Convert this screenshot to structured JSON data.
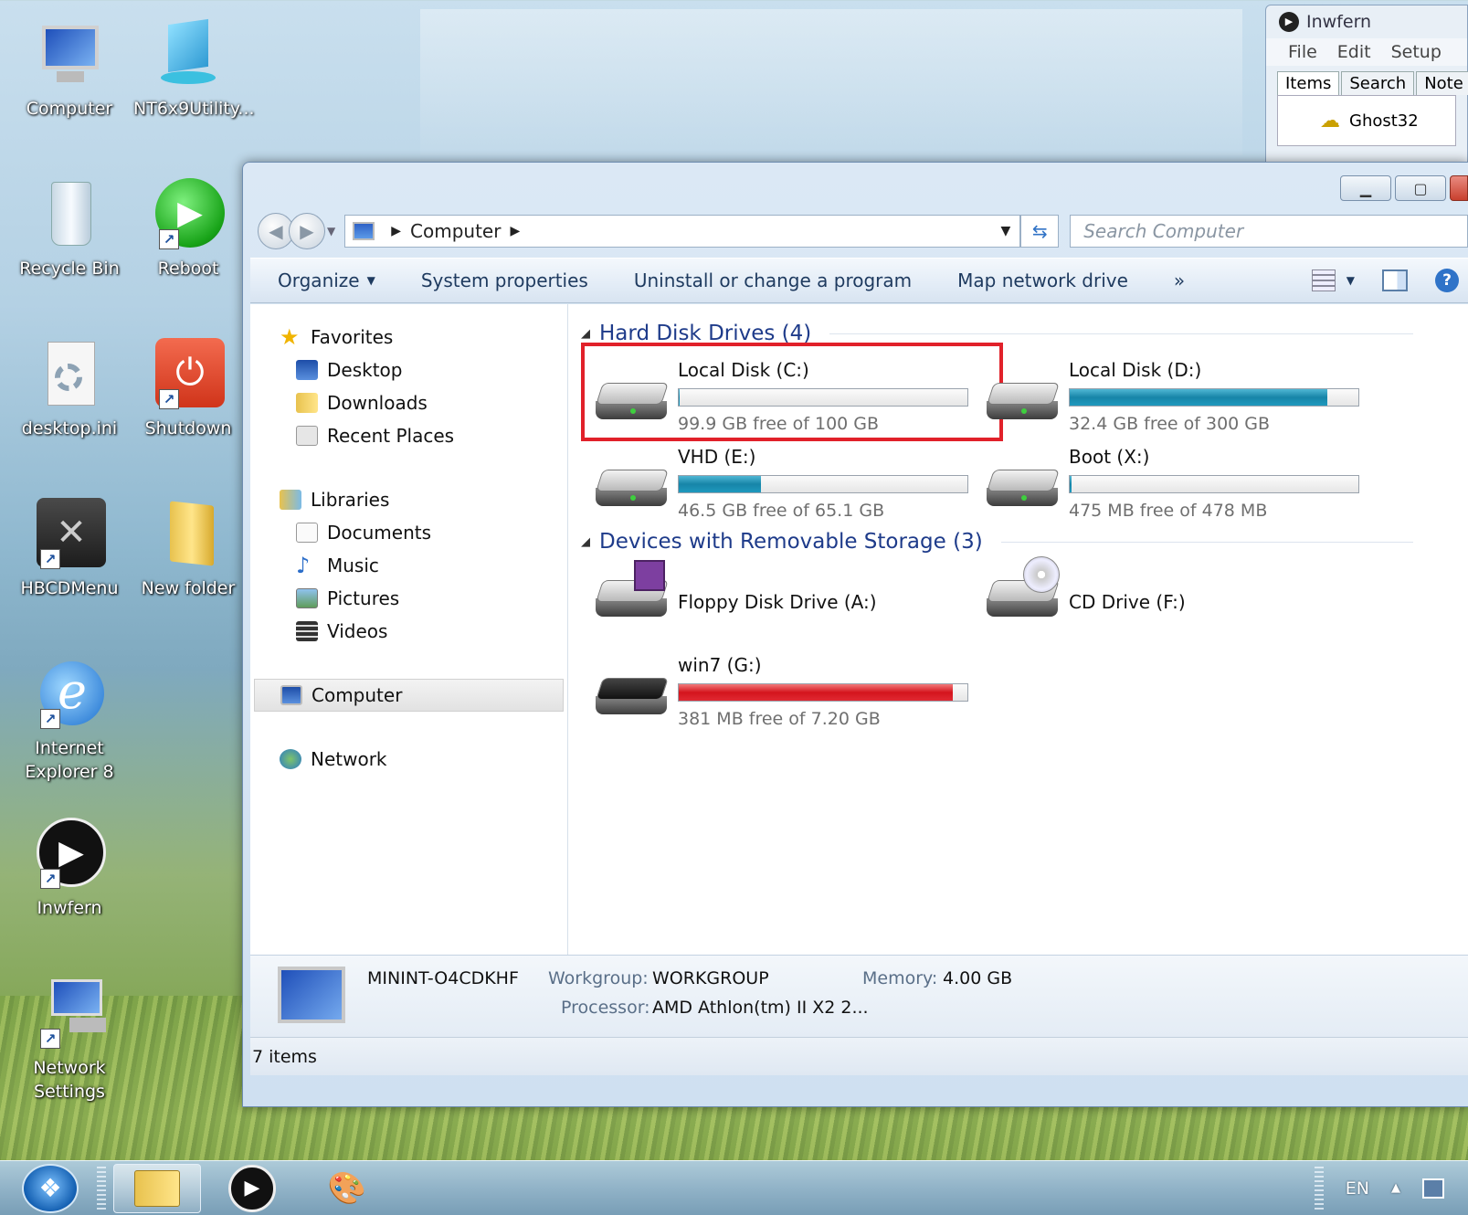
{
  "desktop": {
    "icons": [
      {
        "label": "Computer"
      },
      {
        "label": "NT6x9Utility..."
      },
      {
        "label": "Recycle Bin"
      },
      {
        "label": "Reboot"
      },
      {
        "label": "desktop.ini"
      },
      {
        "label": "Shutdown"
      },
      {
        "label": "HBCDMenu"
      },
      {
        "label": "New folder"
      },
      {
        "label": "Internet Explorer 8"
      },
      {
        "label": "Inwfern"
      },
      {
        "label": "Network Settings"
      }
    ]
  },
  "inwfern": {
    "title": "Inwfern",
    "menu": [
      "File",
      "Edit",
      "Setup"
    ],
    "tabs": [
      "Items",
      "Search",
      "Note"
    ],
    "item": "Ghost32"
  },
  "explorer": {
    "address": {
      "location": "Computer"
    },
    "search": {
      "placeholder": "Search Computer"
    },
    "toolbar": {
      "organize": "Organize",
      "system_properties": "System properties",
      "uninstall": "Uninstall or change a program",
      "map_drive": "Map network drive",
      "more": "»"
    },
    "nav": {
      "favorites": "Favorites",
      "desktop": "Desktop",
      "downloads": "Downloads",
      "recent": "Recent Places",
      "libraries": "Libraries",
      "documents": "Documents",
      "music": "Music",
      "pictures": "Pictures",
      "videos": "Videos",
      "computer": "Computer",
      "network": "Network"
    },
    "groups": {
      "hdd": "Hard Disk Drives (4)",
      "removable": "Devices with Removable Storage (3)"
    },
    "drives": [
      {
        "name": "Local Disk (C:)",
        "free": "99.9 GB free of 100 GB",
        "used_fraction": 0.001
      },
      {
        "name": "Local Disk (D:)",
        "free": "32.4 GB free of 300 GB",
        "used_fraction": 0.892
      },
      {
        "name": "VHD (E:)",
        "free": "46.5 GB free of 65.1 GB",
        "used_fraction": 0.286
      },
      {
        "name": "Boot (X:)",
        "free": "475 MB free of 478 MB",
        "used_fraction": 0.006
      },
      {
        "name": "win7 (G:)",
        "free": "381 MB free of 7.20 GB",
        "used_fraction": 0.948
      }
    ],
    "devices": {
      "floppy": "Floppy Disk Drive (A:)",
      "cd": "CD Drive (F:)"
    },
    "details": {
      "name": "MININT-O4CDKHF",
      "workgroup_label": "Workgroup:",
      "workgroup": "WORKGROUP",
      "memory_label": "Memory:",
      "memory": "4.00 GB",
      "processor_label": "Processor:",
      "processor": "AMD Athlon(tm) II X2 2..."
    },
    "status": "7 items"
  },
  "taskbar": {
    "lang": "EN",
    "tray_arrow": "▲"
  },
  "colors": {
    "highlight": "#e1212a",
    "bar_normal": "#1785a8",
    "bar_full": "#d4141d"
  }
}
